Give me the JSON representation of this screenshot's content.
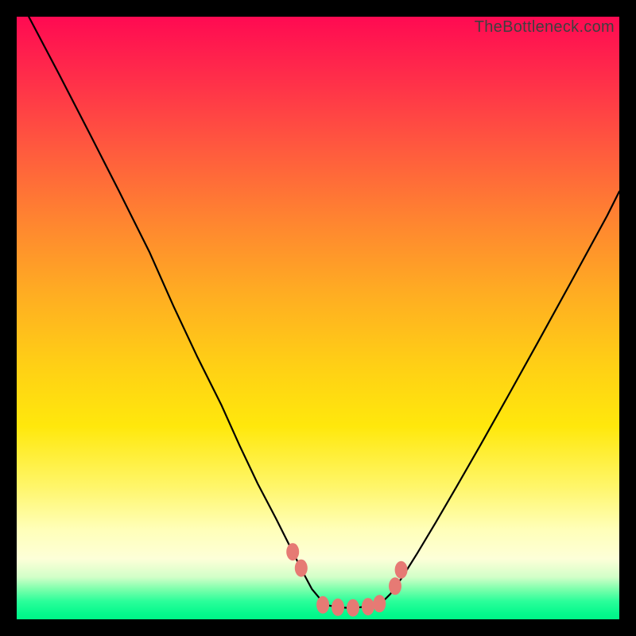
{
  "watermark": "TheBottleneck.com",
  "colors": {
    "frame": "#000000",
    "grad_top": "#ff0a52",
    "grad_mid": "#ffe80c",
    "grad_bottom": "#00f588",
    "curve": "#000000",
    "marker": "#e67a74"
  },
  "chart_data": {
    "type": "line",
    "title": "",
    "xlabel": "",
    "ylabel": "",
    "xlim": [
      0,
      100
    ],
    "ylim": [
      0,
      100
    ],
    "series": [
      {
        "name": "left-curve",
        "x": [
          2,
          7,
          12,
          17,
          22,
          26,
          30,
          34,
          37,
          40,
          43,
          45.5,
          47.5,
          49,
          50.5,
          51.8
        ],
        "y": [
          100,
          90.5,
          80.8,
          71,
          61,
          52,
          43.5,
          35.5,
          28.8,
          22.5,
          16.8,
          11.8,
          7.8,
          5,
          3.2,
          2.3
        ]
      },
      {
        "name": "valley-floor",
        "x": [
          51.8,
          53.2,
          55,
          57,
          59,
          60.5
        ],
        "y": [
          2.3,
          2.0,
          1.9,
          2.0,
          2.3,
          2.7
        ]
      },
      {
        "name": "right-curve",
        "x": [
          60.5,
          62,
          64,
          66.5,
          69.5,
          73,
          77,
          81.5,
          86.5,
          92,
          98,
          100
        ],
        "y": [
          2.7,
          4.2,
          7,
          11,
          16,
          22,
          29,
          37,
          46,
          56,
          67,
          71
        ]
      }
    ],
    "markers": {
      "name": "valley-markers",
      "x": [
        45.8,
        47.2,
        50.8,
        53.3,
        55.8,
        58.3,
        60.2,
        62.8,
        63.8
      ],
      "y": [
        11.2,
        8.5,
        2.4,
        2.0,
        1.9,
        2.1,
        2.6,
        5.5,
        8.2
      ]
    }
  }
}
